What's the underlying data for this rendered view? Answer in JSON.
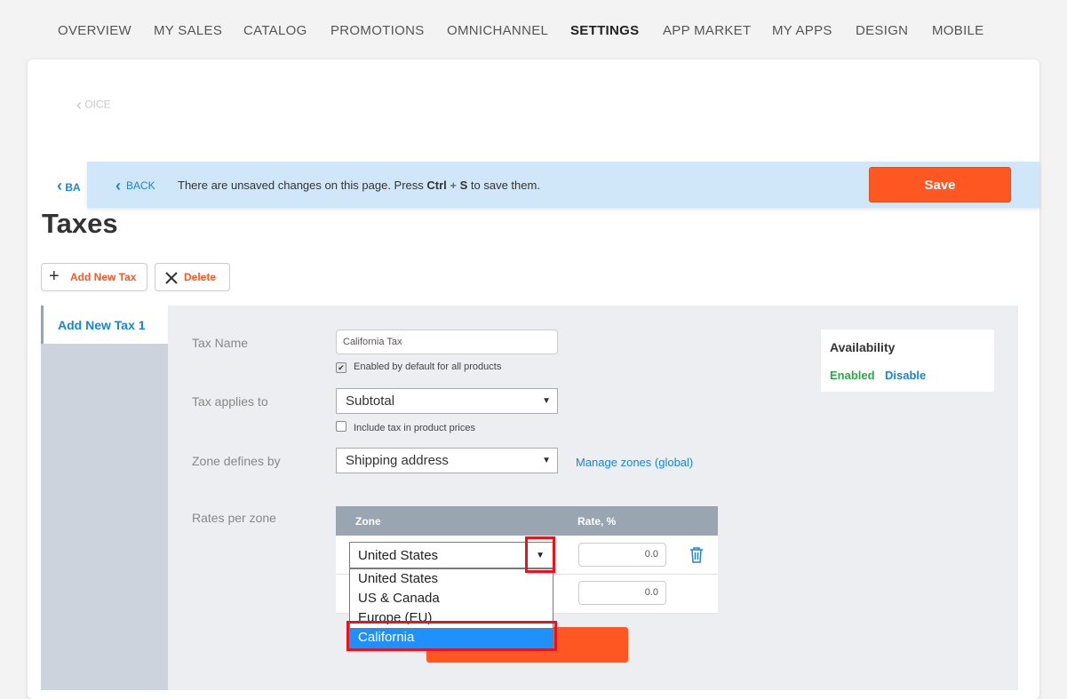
{
  "nav": {
    "items": [
      "OVERVIEW",
      "MY SALES",
      "CATALOG",
      "PROMOTIONS",
      "OMNICHANNEL",
      "SETTINGS",
      "APP MARKET",
      "MY APPS",
      "DESIGN",
      "MOBILE"
    ],
    "active": "SETTINGS"
  },
  "ghost_back": "OICE",
  "back_under": "BA",
  "banner": {
    "back_label": "BACK",
    "message_pre": "There are unsaved changes on this page. Press ",
    "key1": "Ctrl",
    "plus": " + ",
    "key2": "S",
    "message_post": " to save them.",
    "save_label": "Save"
  },
  "page_title": "Taxes",
  "toolbar": {
    "add_label": "Add New Tax",
    "delete_label": "Delete"
  },
  "sidebar": {
    "tab_label": "Add New Tax 1"
  },
  "form": {
    "tax_name_label": "Tax Name",
    "tax_name_value": "California Tax",
    "enabled_default_label": "Enabled by default for all products",
    "applies_label": "Tax applies to",
    "applies_value": "Subtotal",
    "include_label": "Include tax in product prices",
    "zone_defines_label": "Zone defines by",
    "zone_defines_value": "Shipping address",
    "manage_zones_link": "Manage zones (global)",
    "rates_label": "Rates per zone"
  },
  "availability": {
    "title": "Availability",
    "enabled": "Enabled",
    "disable": "Disable"
  },
  "rates_table": {
    "col_zone": "Zone",
    "col_rate": "Rate, %",
    "rows": [
      {
        "zone": "United States",
        "rate": "0.0"
      },
      {
        "zone": "",
        "rate": "0.0"
      }
    ]
  },
  "zone_dropdown": {
    "options": [
      "United States",
      "US & Canada",
      "Europe (EU)",
      "California"
    ],
    "highlighted": "California"
  },
  "colors": {
    "accent": "#ff5722",
    "link": "#1a86d0",
    "enabled": "#2ea84a",
    "highlight": "#e8141b",
    "selected": "#1e90ff"
  }
}
